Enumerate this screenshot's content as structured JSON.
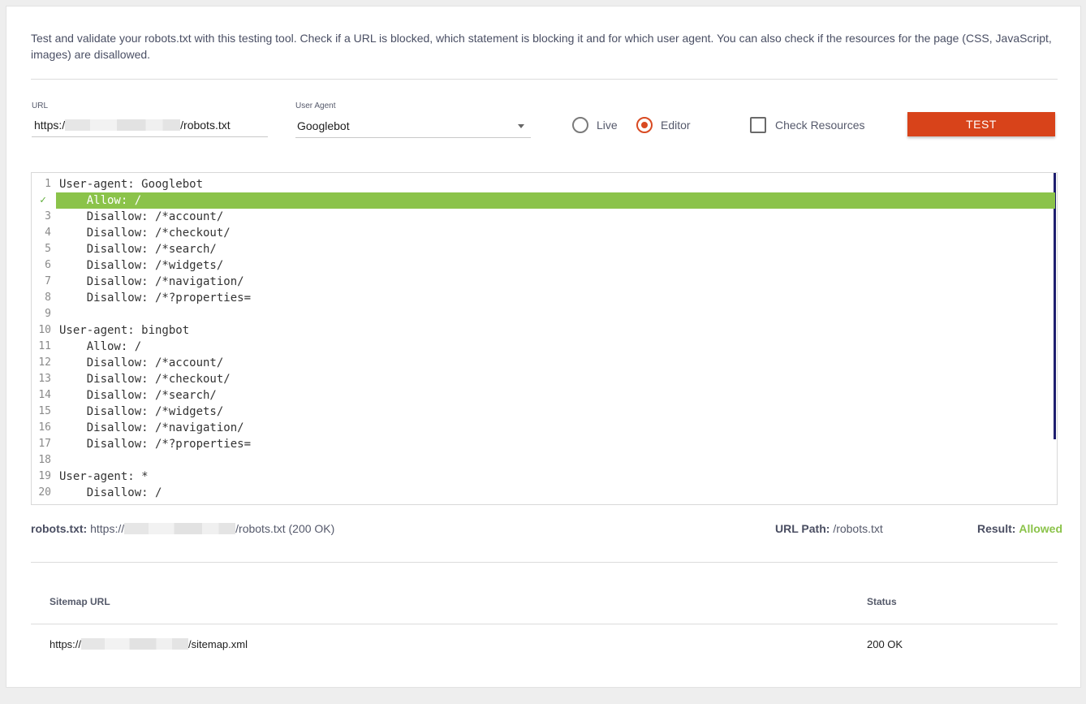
{
  "intro_text": "Test and validate your robots.txt with this testing tool. Check if a URL is blocked, which statement is blocking it and for which user agent. You can also check if the resources for the page (CSS, JavaScript, images) are disallowed.",
  "form": {
    "url_label": "URL",
    "url_prefix": "https:/",
    "url_suffix": "/robots.txt",
    "user_agent_label": "User Agent",
    "user_agent_value": "Googlebot",
    "mode_live": "Live",
    "mode_editor": "Editor",
    "mode_selected": "Editor",
    "check_resources_label": "Check Resources",
    "check_resources_checked": false,
    "test_button": "TEST"
  },
  "editor": {
    "highlighted_line": 2,
    "lines": [
      {
        "num": "1",
        "text": "User-agent: Googlebot"
      },
      {
        "num": "2",
        "text": "    Allow: /"
      },
      {
        "num": "3",
        "text": "    Disallow: /*account/"
      },
      {
        "num": "4",
        "text": "    Disallow: /*checkout/"
      },
      {
        "num": "5",
        "text": "    Disallow: /*search/"
      },
      {
        "num": "6",
        "text": "    Disallow: /*widgets/"
      },
      {
        "num": "7",
        "text": "    Disallow: /*navigation/"
      },
      {
        "num": "8",
        "text": "    Disallow: /*?properties="
      },
      {
        "num": "9",
        "text": ""
      },
      {
        "num": "10",
        "text": "User-agent: bingbot"
      },
      {
        "num": "11",
        "text": "    Allow: /"
      },
      {
        "num": "12",
        "text": "    Disallow: /*account/"
      },
      {
        "num": "13",
        "text": "    Disallow: /*checkout/"
      },
      {
        "num": "14",
        "text": "    Disallow: /*search/"
      },
      {
        "num": "15",
        "text": "    Disallow: /*widgets/"
      },
      {
        "num": "16",
        "text": "    Disallow: /*navigation/"
      },
      {
        "num": "17",
        "text": "    Disallow: /*?properties="
      },
      {
        "num": "18",
        "text": ""
      },
      {
        "num": "19",
        "text": "User-agent: *"
      },
      {
        "num": "20",
        "text": "    Disallow: /"
      }
    ]
  },
  "results": {
    "robots_label": "robots.txt:",
    "robots_prefix": "https://",
    "robots_suffix": "/robots.txt (200 OK)",
    "url_path_label": "URL Path:",
    "url_path_value": "/robots.txt",
    "result_label": "Result:",
    "result_value": "Allowed"
  },
  "sitemaps": {
    "headers": {
      "url": "Sitemap URL",
      "status": "Status"
    },
    "rows": [
      {
        "url_prefix": "https://",
        "url_suffix": "/sitemap.xml",
        "status": "200 OK"
      }
    ]
  },
  "colors": {
    "accent": "#d8431a",
    "highlight": "#8bc34a",
    "allowed": "#8bc34a"
  }
}
